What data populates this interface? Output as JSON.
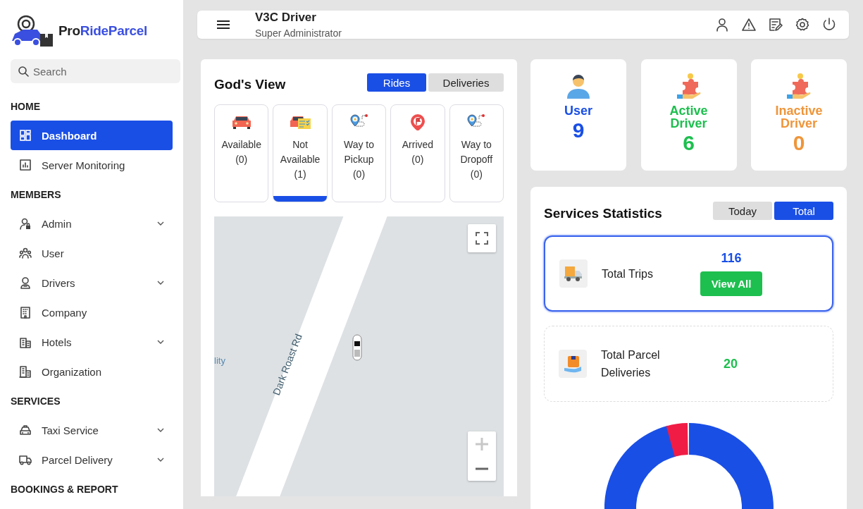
{
  "brand": {
    "first": "Pro",
    "second": "RideParcel"
  },
  "sidebar": {
    "search": {
      "placeholder": "Search"
    },
    "sections": [
      {
        "title": "HOME",
        "items": [
          {
            "label": "Dashboard",
            "selected": true,
            "expandable": false
          },
          {
            "label": "Server Monitoring",
            "selected": false,
            "expandable": false
          }
        ]
      },
      {
        "title": "MEMBERS",
        "items": [
          {
            "label": "Admin",
            "selected": false,
            "expandable": true
          },
          {
            "label": "User",
            "selected": false,
            "expandable": false
          },
          {
            "label": "Drivers",
            "selected": false,
            "expandable": true
          },
          {
            "label": "Company",
            "selected": false,
            "expandable": false
          },
          {
            "label": "Hotels",
            "selected": false,
            "expandable": true
          },
          {
            "label": "Organization",
            "selected": false,
            "expandable": false
          }
        ]
      },
      {
        "title": "SERVICES",
        "items": [
          {
            "label": "Taxi Service",
            "selected": false,
            "expandable": true
          },
          {
            "label": "Parcel Delivery",
            "selected": false,
            "expandable": true
          }
        ]
      },
      {
        "title": "BOOKINGS & REPORT"
      }
    ]
  },
  "header": {
    "title": "V3C Driver",
    "subtitle": "Super Administrator"
  },
  "gods_view": {
    "title": "God's View",
    "tabs": [
      {
        "label": "Rides",
        "selected": true
      },
      {
        "label": "Deliveries",
        "selected": false
      }
    ],
    "statuses": [
      {
        "label": "Available",
        "count": "(0)",
        "selected": false
      },
      {
        "label": "Not Available",
        "count": "(1)",
        "selected": true
      },
      {
        "label": "Way to Pickup",
        "count": "(0)",
        "selected": false
      },
      {
        "label": "Arrived",
        "count": "(0)",
        "selected": false
      },
      {
        "label": "Way to Dropoff",
        "count": "(0)",
        "selected": false
      }
    ],
    "map": {
      "road_label": "Dark Roast Rd",
      "place_label": "lity"
    }
  },
  "stats": [
    {
      "label": "User",
      "value": "9",
      "color": "#1a4fe6"
    },
    {
      "label": "Active Driver",
      "value": "6",
      "color": "#1dbf4e"
    },
    {
      "label": "Inactive Driver",
      "value": "0",
      "color": "#ef953a"
    }
  ],
  "services": {
    "title": "Services Statistics",
    "tabs": [
      {
        "label": "Today",
        "selected": false
      },
      {
        "label": "Total",
        "selected": true
      }
    ],
    "rows": [
      {
        "label": "Total Trips",
        "value": "116",
        "color": "#1a4fe6",
        "selected": true,
        "button": "View All"
      },
      {
        "label": "Total Parcel Deliveries",
        "value": "20",
        "color": "#1dbf4e",
        "selected": false
      }
    ]
  }
}
